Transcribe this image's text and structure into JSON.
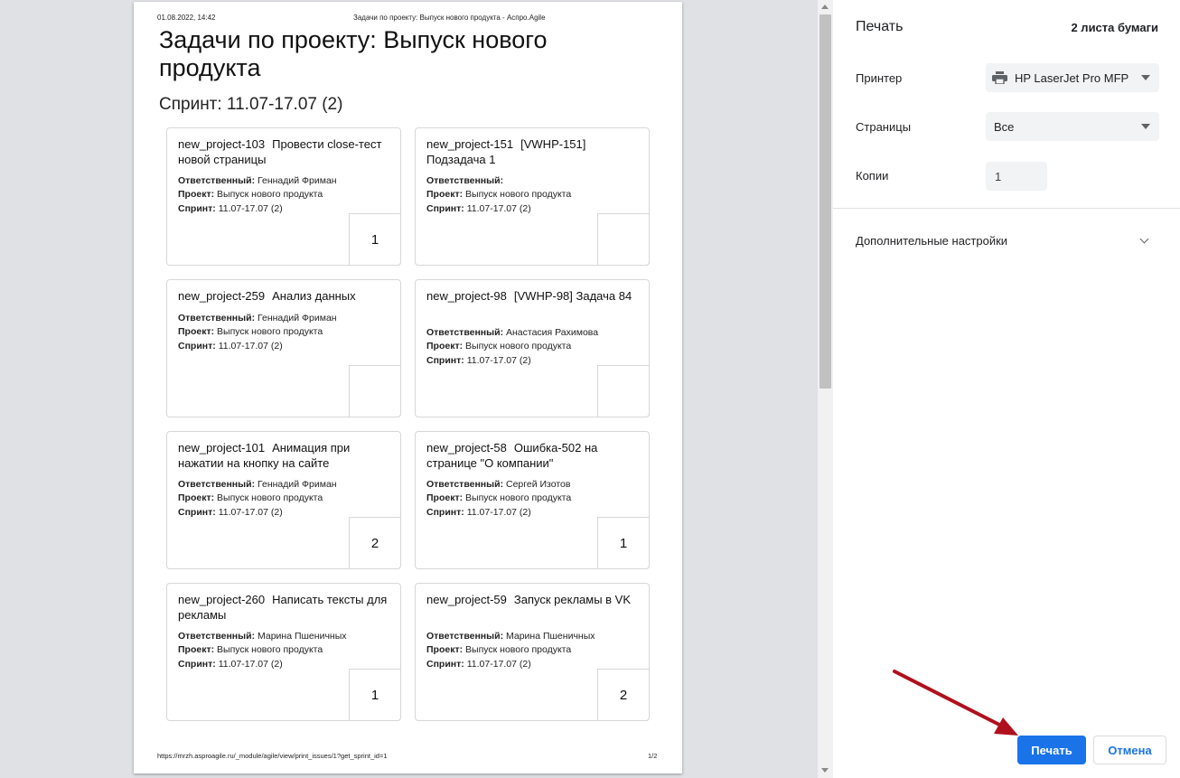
{
  "page": {
    "header_date": "01.08.2022, 14:42",
    "header_title": "Задачи по проекту: Выпуск нового продукта - Аспро.Agile",
    "title": "Задачи по проекту: Выпуск нового продукта",
    "sprint_heading": "Спринт: 11.07-17.07 (2)",
    "footer_url": "https://mrzh.asproagile.ru/_module/agile/view/print_issues/1?get_sprint_id=1",
    "footer_page": "1/2"
  },
  "labels": {
    "assignee": "Ответственный:",
    "project": "Проект:",
    "sprint": "Спринт:"
  },
  "cards": [
    {
      "key": "new_project-103",
      "title": "Провести close-тест новой страницы",
      "assignee": "Геннадий Фриман",
      "project": "Выпуск нового продукта",
      "sprint": "11.07-17.07 (2)",
      "points": "1"
    },
    {
      "key": "new_project-151",
      "title": "[VWHP-151] Подзадача 1",
      "assignee": "",
      "project": "Выпуск нового продукта",
      "sprint": "11.07-17.07 (2)",
      "points": ""
    },
    {
      "key": "new_project-259",
      "title": "Анализ данных",
      "assignee": "Геннадий Фриман",
      "project": "Выпуск нового продукта",
      "sprint": "11.07-17.07 (2)",
      "points": ""
    },
    {
      "key": "new_project-98",
      "title": "[VWHP-98] Задача 84",
      "assignee": "Анастасия Рахимова",
      "project": "Выпуск нового продукта",
      "sprint": "11.07-17.07 (2)",
      "points": ""
    },
    {
      "key": "new_project-101",
      "title": "Анимация при нажатии на кнопку на сайте",
      "assignee": "Геннадий Фриман",
      "project": "Выпуск нового продукта",
      "sprint": "11.07-17.07 (2)",
      "points": "2"
    },
    {
      "key": "new_project-58",
      "title": "Ошибка-502 на странице \"О компании\"",
      "assignee": "Сергей Изотов",
      "project": "Выпуск нового продукта",
      "sprint": "11.07-17.07 (2)",
      "points": "1"
    },
    {
      "key": "new_project-260",
      "title": "Написать тексты для рекламы",
      "assignee": "Марина Пшеничных",
      "project": "Выпуск нового продукта",
      "sprint": "11.07-17.07 (2)",
      "points": "1"
    },
    {
      "key": "new_project-59",
      "title": "Запуск рекламы в VK",
      "assignee": "Марина Пшеничных",
      "project": "Выпуск нового продукта",
      "sprint": "11.07-17.07 (2)",
      "points": "2"
    }
  ],
  "sidebar": {
    "title": "Печать",
    "sheets": "2 листа бумаги",
    "printer_label": "Принтер",
    "printer_value": "HP LaserJet Pro MFP",
    "pages_label": "Страницы",
    "pages_value": "Все",
    "copies_label": "Копии",
    "copies_value": "1",
    "more_settings": "Дополнительные настройки",
    "print_button": "Печать",
    "cancel_button": "Отмена"
  },
  "icons": {
    "printer": "printer-icon",
    "chevron": "chevron-down-icon",
    "annotation": "red-arrow"
  },
  "colors": {
    "accent": "#1a73e8",
    "annotation_arrow": "#b0101e"
  }
}
